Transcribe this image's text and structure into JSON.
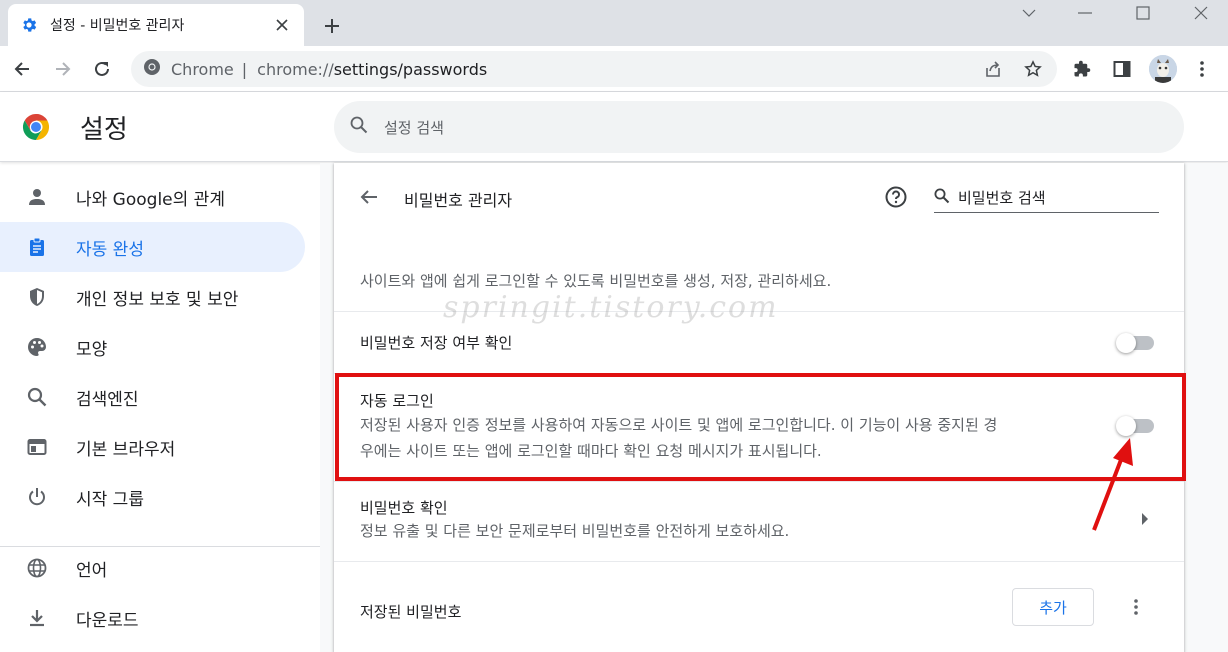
{
  "tab": {
    "title": "설정 - 비밀번호 관리자"
  },
  "omnibox": {
    "site": "Chrome",
    "url_prefix": "chrome://",
    "url_rest": "settings/passwords"
  },
  "header": {
    "title": "설정",
    "search_placeholder": "설정 검색"
  },
  "sidebar": {
    "items": [
      {
        "label": "나와 Google의 관계",
        "icon": "person-icon"
      },
      {
        "label": "자동 완성",
        "icon": "clipboard-icon",
        "active": true
      },
      {
        "label": "개인 정보 보호 및 보안",
        "icon": "shield-icon"
      },
      {
        "label": "모양",
        "icon": "palette-icon"
      },
      {
        "label": "검색엔진",
        "icon": "search-icon"
      },
      {
        "label": "기본 브라우저",
        "icon": "browser-icon"
      },
      {
        "label": "시작 그룹",
        "icon": "power-icon"
      },
      {
        "label": "언어",
        "icon": "globe-icon"
      },
      {
        "label": "다운로드",
        "icon": "download-icon"
      }
    ]
  },
  "page": {
    "title": "비밀번호 관리자",
    "search_placeholder": "비밀번호 검색",
    "description": "사이트와 앱에 쉽게 로그인할 수 있도록 비밀번호를 생성, 저장, 관리하세요.",
    "offer_save": {
      "label": "비밀번호 저장 여부 확인",
      "enabled": false
    },
    "auto_signin": {
      "label": "자동 로그인",
      "line1": "저장된 사용자 인증 정보를 사용하여 자동으로 사이트 및 앱에 로그인합니다. 이 기능이 사용 중지된 경",
      "line2": "우에는 사이트 또는 앱에 로그인할 때마다 확인 요청 메시지가 표시됩니다.",
      "enabled": false
    },
    "check_passwords": {
      "label": "비밀번호 확인",
      "sub": "정보 유출 및 다른 보안 문제로부터 비밀번호를 안전하게 보호하세요."
    },
    "saved_passwords": {
      "label": "저장된 비밀번호",
      "add_label": "추가"
    }
  },
  "annotation": {
    "watermark": "springit.tistory.com",
    "highlight_color": "#e01010"
  }
}
